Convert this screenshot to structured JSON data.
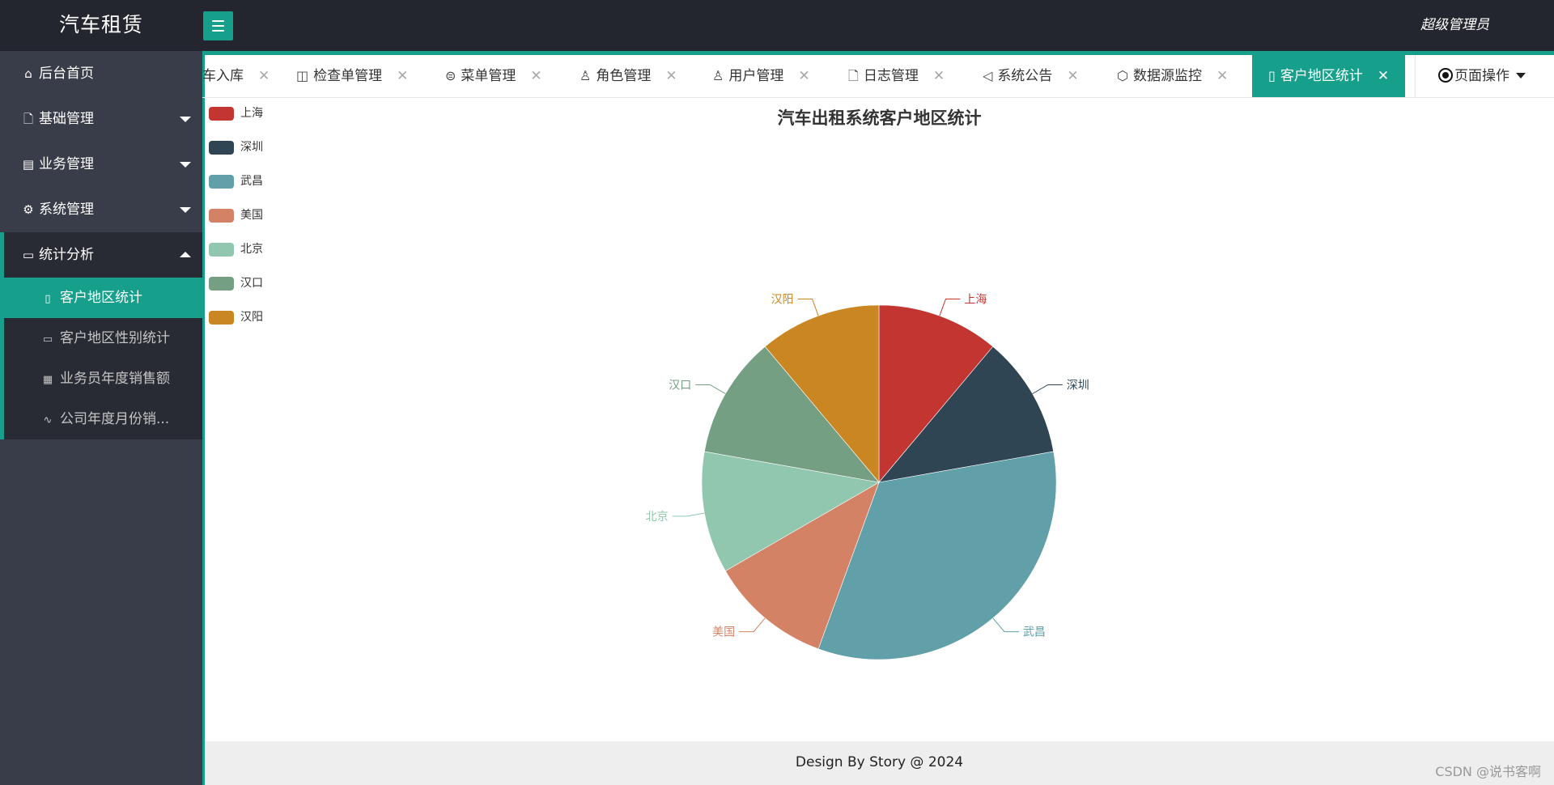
{
  "app": {
    "title": "汽车租赁",
    "user": "超级管理员"
  },
  "sidebar": {
    "items": [
      {
        "label": "后台首页",
        "icon": "home-icon"
      },
      {
        "label": "基础管理",
        "icon": "file-icon"
      },
      {
        "label": "业务管理",
        "icon": "book-icon"
      },
      {
        "label": "系统管理",
        "icon": "gear-icon"
      }
    ],
    "open_group": {
      "label": "统计分析",
      "icon": "monitor-icon",
      "children": [
        {
          "label": "客户地区统计",
          "icon": "clipboard-icon",
          "active": true
        },
        {
          "label": "客户地区性别统计",
          "icon": "monitor-icon"
        },
        {
          "label": "业务员年度销售额",
          "icon": "table-icon"
        },
        {
          "label": "公司年度月份销...",
          "icon": "pulse-icon"
        }
      ]
    }
  },
  "tabs": [
    {
      "label": "车入库",
      "icon": ""
    },
    {
      "label": "检查单管理",
      "icon": "open-book-icon"
    },
    {
      "label": "菜单管理",
      "icon": "menu-circle-icon"
    },
    {
      "label": "角色管理",
      "icon": "person-icon"
    },
    {
      "label": "用户管理",
      "icon": "users-icon"
    },
    {
      "label": "日志管理",
      "icon": "note-icon"
    },
    {
      "label": "系统公告",
      "icon": "speaker-icon"
    },
    {
      "label": "数据源监控",
      "icon": "cube-icon"
    },
    {
      "label": "客户地区统计",
      "icon": "clipboard-icon",
      "active": true
    }
  ],
  "page_ops": {
    "label": "页面操作"
  },
  "chart_data": {
    "type": "pie",
    "title": "汽车出租系统客户地区统计",
    "legend_position": "top-left",
    "slices": [
      {
        "name": "上海",
        "value": 1,
        "color": "#c23531"
      },
      {
        "name": "深圳",
        "value": 1,
        "color": "#2f4554"
      },
      {
        "name": "武昌",
        "value": 3,
        "color": "#61a0a8"
      },
      {
        "name": "美国",
        "value": 1,
        "color": "#d48265"
      },
      {
        "name": "北京",
        "value": 1,
        "color": "#91c7ae"
      },
      {
        "name": "汉口",
        "value": 1,
        "color": "#749f83"
      },
      {
        "name": "汉阳",
        "value": 1,
        "color": "#ca8622"
      }
    ]
  },
  "footer": {
    "text": "Design By Story @ 2024"
  },
  "watermark": "CSDN @说书客啊",
  "colors": {
    "accent": "#16a08c",
    "header": "#23262e",
    "sidebar": "#393d49"
  }
}
